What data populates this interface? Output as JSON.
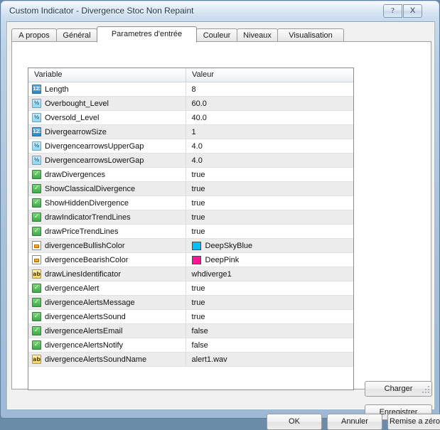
{
  "window": {
    "title": "Custom Indicator - Divergence Stoc Non Repaint",
    "help_label": "?",
    "close_label": "X"
  },
  "tabs": [
    {
      "label": "A propos",
      "active": false
    },
    {
      "label": "Général",
      "active": false
    },
    {
      "label": "Parametres d'entrée",
      "active": true
    },
    {
      "label": "Couleur",
      "active": false
    },
    {
      "label": "Niveaux",
      "active": false
    },
    {
      "label": "Visualisation",
      "active": false
    }
  ],
  "table": {
    "columns": [
      "Variable",
      "Valeur"
    ],
    "rows": [
      {
        "icon": "int-icon",
        "icon_text": "123",
        "variable": "Length",
        "value": "8"
      },
      {
        "icon": "double-icon",
        "icon_text": "½",
        "variable": "Overbought_Level",
        "value": "60.0"
      },
      {
        "icon": "double-icon",
        "icon_text": "½",
        "variable": "Oversold_Level",
        "value": "40.0"
      },
      {
        "icon": "int-icon",
        "icon_text": "123",
        "variable": "DivergearrowSize",
        "value": "1"
      },
      {
        "icon": "double-icon",
        "icon_text": "½",
        "variable": "DivergencearrowsUpperGap",
        "value": "4.0"
      },
      {
        "icon": "double-icon",
        "icon_text": "½",
        "variable": "DivergencearrowsLowerGap",
        "value": "4.0"
      },
      {
        "icon": "bool-icon",
        "icon_text": "",
        "variable": "drawDivergences",
        "value": "true"
      },
      {
        "icon": "bool-icon",
        "icon_text": "",
        "variable": "ShowClassicalDivergence",
        "value": "true"
      },
      {
        "icon": "bool-icon",
        "icon_text": "",
        "variable": "ShowHiddenDivergence",
        "value": "true"
      },
      {
        "icon": "bool-icon",
        "icon_text": "",
        "variable": "drawIndicatorTrendLines",
        "value": "true"
      },
      {
        "icon": "bool-icon",
        "icon_text": "",
        "variable": "drawPriceTrendLines",
        "value": "true"
      },
      {
        "icon": "color-icon",
        "icon_text": "",
        "variable": "divergenceBullishColor",
        "value": "DeepSkyBlue",
        "swatch": "#00BFFF"
      },
      {
        "icon": "color-icon",
        "icon_text": "",
        "variable": "divergenceBearishColor",
        "value": "DeepPink",
        "swatch": "#FF1493"
      },
      {
        "icon": "string-icon",
        "icon_text": "ab",
        "variable": "drawLinesIdentificator",
        "value": "whdiverge1"
      },
      {
        "icon": "bool-icon",
        "icon_text": "",
        "variable": "divergenceAlert",
        "value": "true"
      },
      {
        "icon": "bool-icon",
        "icon_text": "",
        "variable": "divergenceAlertsMessage",
        "value": "true"
      },
      {
        "icon": "bool-icon",
        "icon_text": "",
        "variable": "divergenceAlertsSound",
        "value": "true"
      },
      {
        "icon": "bool-icon",
        "icon_text": "",
        "variable": "divergenceAlertsEmail",
        "value": "false"
      },
      {
        "icon": "bool-icon",
        "icon_text": "",
        "variable": "divergenceAlertsNotify",
        "value": "false"
      },
      {
        "icon": "string-icon",
        "icon_text": "ab",
        "variable": "divergenceAlertsSoundName",
        "value": "alert1.wav"
      }
    ]
  },
  "side_buttons": {
    "load_label": "Charger",
    "save_label": "Enregistrer"
  },
  "bottom_buttons": {
    "ok_label": "OK",
    "cancel_label": "Annuler",
    "reset_label": "Remise a zéro"
  },
  "colors": {
    "bullish": "#00BFFF",
    "bearish": "#FF1493"
  }
}
